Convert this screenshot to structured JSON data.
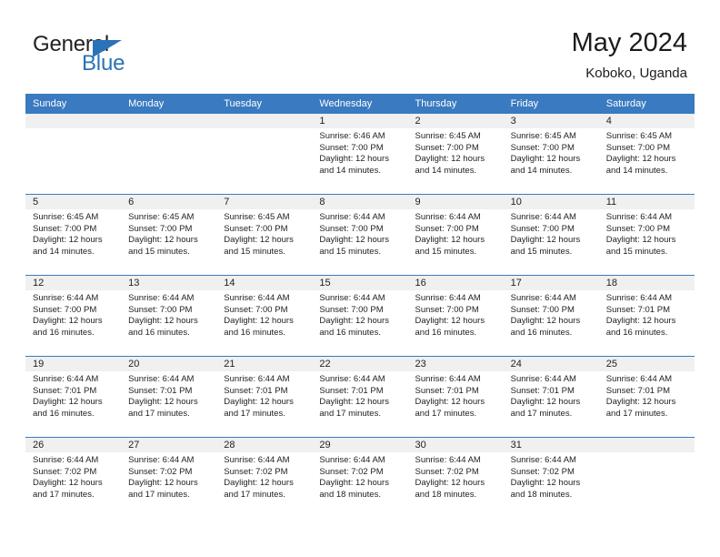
{
  "brand": {
    "name_top": "General",
    "name_bottom": "Blue",
    "accent_color": "#2b72b8"
  },
  "header": {
    "title": "May 2024",
    "subtitle": "Koboko, Uganda"
  },
  "calendar": {
    "header_bg": "#3a7ac0",
    "daynum_band_bg": "#f0f0f0",
    "weekdays": [
      "Sunday",
      "Monday",
      "Tuesday",
      "Wednesday",
      "Thursday",
      "Friday",
      "Saturday"
    ],
    "weeks": [
      [
        {
          "day": "",
          "sunrise": "",
          "sunset": "",
          "daylight1": "",
          "daylight2": ""
        },
        {
          "day": "",
          "sunrise": "",
          "sunset": "",
          "daylight1": "",
          "daylight2": ""
        },
        {
          "day": "",
          "sunrise": "",
          "sunset": "",
          "daylight1": "",
          "daylight2": ""
        },
        {
          "day": "1",
          "sunrise": "Sunrise: 6:46 AM",
          "sunset": "Sunset: 7:00 PM",
          "daylight1": "Daylight: 12 hours",
          "daylight2": "and 14 minutes."
        },
        {
          "day": "2",
          "sunrise": "Sunrise: 6:45 AM",
          "sunset": "Sunset: 7:00 PM",
          "daylight1": "Daylight: 12 hours",
          "daylight2": "and 14 minutes."
        },
        {
          "day": "3",
          "sunrise": "Sunrise: 6:45 AM",
          "sunset": "Sunset: 7:00 PM",
          "daylight1": "Daylight: 12 hours",
          "daylight2": "and 14 minutes."
        },
        {
          "day": "4",
          "sunrise": "Sunrise: 6:45 AM",
          "sunset": "Sunset: 7:00 PM",
          "daylight1": "Daylight: 12 hours",
          "daylight2": "and 14 minutes."
        }
      ],
      [
        {
          "day": "5",
          "sunrise": "Sunrise: 6:45 AM",
          "sunset": "Sunset: 7:00 PM",
          "daylight1": "Daylight: 12 hours",
          "daylight2": "and 14 minutes."
        },
        {
          "day": "6",
          "sunrise": "Sunrise: 6:45 AM",
          "sunset": "Sunset: 7:00 PM",
          "daylight1": "Daylight: 12 hours",
          "daylight2": "and 15 minutes."
        },
        {
          "day": "7",
          "sunrise": "Sunrise: 6:45 AM",
          "sunset": "Sunset: 7:00 PM",
          "daylight1": "Daylight: 12 hours",
          "daylight2": "and 15 minutes."
        },
        {
          "day": "8",
          "sunrise": "Sunrise: 6:44 AM",
          "sunset": "Sunset: 7:00 PM",
          "daylight1": "Daylight: 12 hours",
          "daylight2": "and 15 minutes."
        },
        {
          "day": "9",
          "sunrise": "Sunrise: 6:44 AM",
          "sunset": "Sunset: 7:00 PM",
          "daylight1": "Daylight: 12 hours",
          "daylight2": "and 15 minutes."
        },
        {
          "day": "10",
          "sunrise": "Sunrise: 6:44 AM",
          "sunset": "Sunset: 7:00 PM",
          "daylight1": "Daylight: 12 hours",
          "daylight2": "and 15 minutes."
        },
        {
          "day": "11",
          "sunrise": "Sunrise: 6:44 AM",
          "sunset": "Sunset: 7:00 PM",
          "daylight1": "Daylight: 12 hours",
          "daylight2": "and 15 minutes."
        }
      ],
      [
        {
          "day": "12",
          "sunrise": "Sunrise: 6:44 AM",
          "sunset": "Sunset: 7:00 PM",
          "daylight1": "Daylight: 12 hours",
          "daylight2": "and 16 minutes."
        },
        {
          "day": "13",
          "sunrise": "Sunrise: 6:44 AM",
          "sunset": "Sunset: 7:00 PM",
          "daylight1": "Daylight: 12 hours",
          "daylight2": "and 16 minutes."
        },
        {
          "day": "14",
          "sunrise": "Sunrise: 6:44 AM",
          "sunset": "Sunset: 7:00 PM",
          "daylight1": "Daylight: 12 hours",
          "daylight2": "and 16 minutes."
        },
        {
          "day": "15",
          "sunrise": "Sunrise: 6:44 AM",
          "sunset": "Sunset: 7:00 PM",
          "daylight1": "Daylight: 12 hours",
          "daylight2": "and 16 minutes."
        },
        {
          "day": "16",
          "sunrise": "Sunrise: 6:44 AM",
          "sunset": "Sunset: 7:00 PM",
          "daylight1": "Daylight: 12 hours",
          "daylight2": "and 16 minutes."
        },
        {
          "day": "17",
          "sunrise": "Sunrise: 6:44 AM",
          "sunset": "Sunset: 7:00 PM",
          "daylight1": "Daylight: 12 hours",
          "daylight2": "and 16 minutes."
        },
        {
          "day": "18",
          "sunrise": "Sunrise: 6:44 AM",
          "sunset": "Sunset: 7:01 PM",
          "daylight1": "Daylight: 12 hours",
          "daylight2": "and 16 minutes."
        }
      ],
      [
        {
          "day": "19",
          "sunrise": "Sunrise: 6:44 AM",
          "sunset": "Sunset: 7:01 PM",
          "daylight1": "Daylight: 12 hours",
          "daylight2": "and 16 minutes."
        },
        {
          "day": "20",
          "sunrise": "Sunrise: 6:44 AM",
          "sunset": "Sunset: 7:01 PM",
          "daylight1": "Daylight: 12 hours",
          "daylight2": "and 17 minutes."
        },
        {
          "day": "21",
          "sunrise": "Sunrise: 6:44 AM",
          "sunset": "Sunset: 7:01 PM",
          "daylight1": "Daylight: 12 hours",
          "daylight2": "and 17 minutes."
        },
        {
          "day": "22",
          "sunrise": "Sunrise: 6:44 AM",
          "sunset": "Sunset: 7:01 PM",
          "daylight1": "Daylight: 12 hours",
          "daylight2": "and 17 minutes."
        },
        {
          "day": "23",
          "sunrise": "Sunrise: 6:44 AM",
          "sunset": "Sunset: 7:01 PM",
          "daylight1": "Daylight: 12 hours",
          "daylight2": "and 17 minutes."
        },
        {
          "day": "24",
          "sunrise": "Sunrise: 6:44 AM",
          "sunset": "Sunset: 7:01 PM",
          "daylight1": "Daylight: 12 hours",
          "daylight2": "and 17 minutes."
        },
        {
          "day": "25",
          "sunrise": "Sunrise: 6:44 AM",
          "sunset": "Sunset: 7:01 PM",
          "daylight1": "Daylight: 12 hours",
          "daylight2": "and 17 minutes."
        }
      ],
      [
        {
          "day": "26",
          "sunrise": "Sunrise: 6:44 AM",
          "sunset": "Sunset: 7:02 PM",
          "daylight1": "Daylight: 12 hours",
          "daylight2": "and 17 minutes."
        },
        {
          "day": "27",
          "sunrise": "Sunrise: 6:44 AM",
          "sunset": "Sunset: 7:02 PM",
          "daylight1": "Daylight: 12 hours",
          "daylight2": "and 17 minutes."
        },
        {
          "day": "28",
          "sunrise": "Sunrise: 6:44 AM",
          "sunset": "Sunset: 7:02 PM",
          "daylight1": "Daylight: 12 hours",
          "daylight2": "and 17 minutes."
        },
        {
          "day": "29",
          "sunrise": "Sunrise: 6:44 AM",
          "sunset": "Sunset: 7:02 PM",
          "daylight1": "Daylight: 12 hours",
          "daylight2": "and 18 minutes."
        },
        {
          "day": "30",
          "sunrise": "Sunrise: 6:44 AM",
          "sunset": "Sunset: 7:02 PM",
          "daylight1": "Daylight: 12 hours",
          "daylight2": "and 18 minutes."
        },
        {
          "day": "31",
          "sunrise": "Sunrise: 6:44 AM",
          "sunset": "Sunset: 7:02 PM",
          "daylight1": "Daylight: 12 hours",
          "daylight2": "and 18 minutes."
        },
        {
          "day": "",
          "sunrise": "",
          "sunset": "",
          "daylight1": "",
          "daylight2": ""
        }
      ]
    ]
  }
}
